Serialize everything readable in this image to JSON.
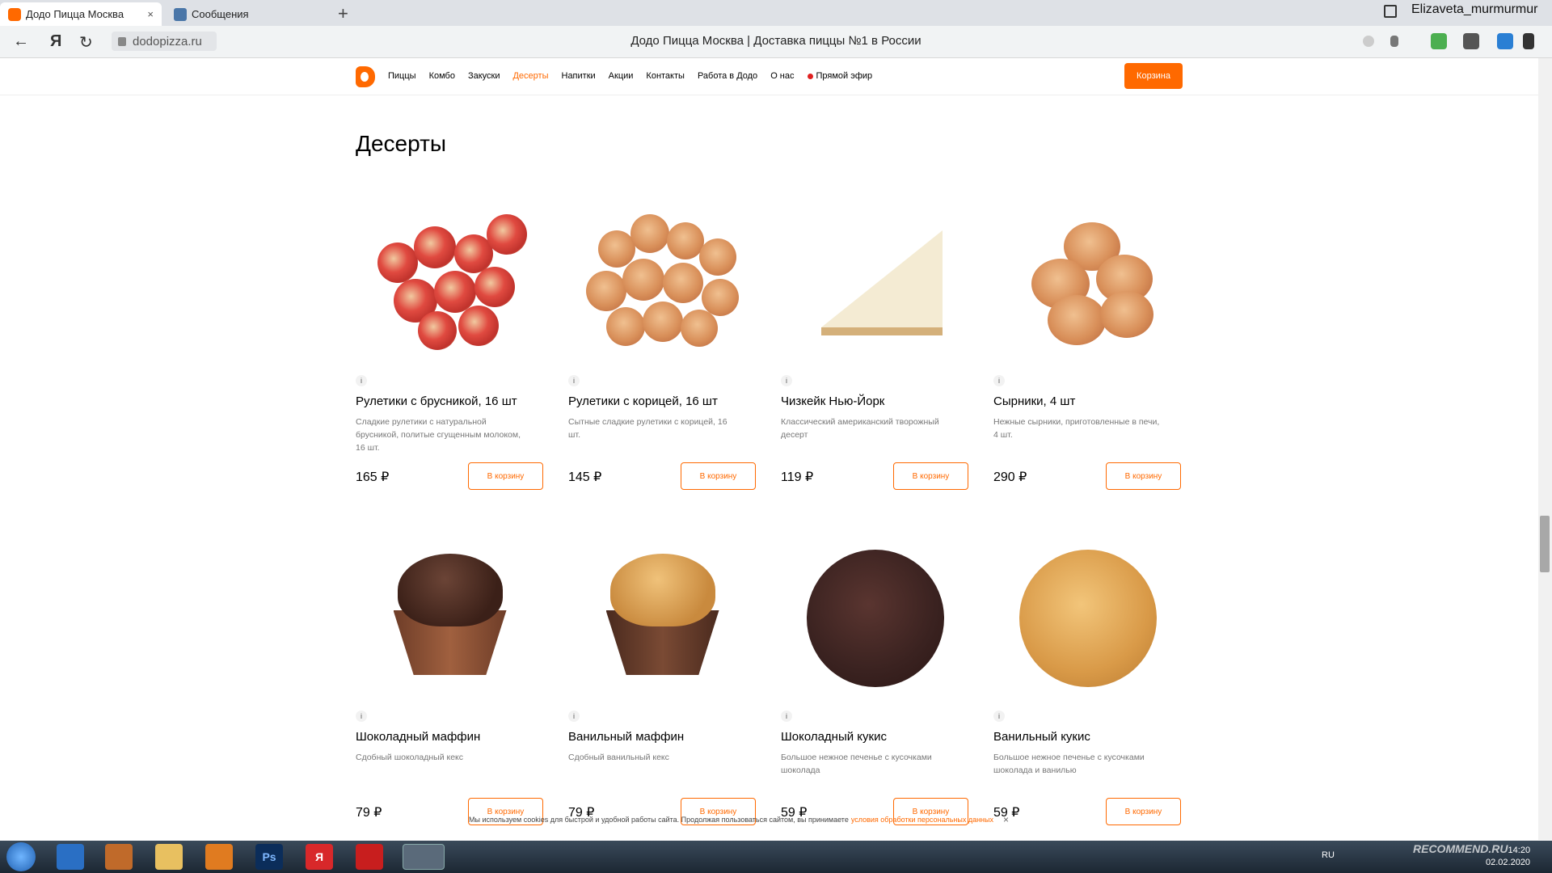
{
  "browser": {
    "tabs": [
      {
        "title": "Додо Пицца Москва",
        "close": "×"
      },
      {
        "title": "Сообщения"
      }
    ],
    "new_tab": "+",
    "profile_name": "Elizaveta_murmurmur",
    "url": "dodopizza.ru",
    "page_title": "Додо Пицца Москва | Доставка пиццы №1 в России",
    "back": "←",
    "yandex": "Я",
    "reload": "↻"
  },
  "site": {
    "nav": [
      "Пиццы",
      "Комбо",
      "Закуски",
      "Десерты",
      "Напитки",
      "Акции",
      "Контакты",
      "Работа в Додо",
      "О нас",
      "Прямой эфир"
    ],
    "active_nav": "Десерты",
    "cart_label": "Корзина",
    "heading": "Десерты",
    "info_glyph": "i",
    "add_label": "В корзину",
    "products": [
      {
        "title": "Рулетики с брусникой, 16 шт",
        "desc": "Сладкие рулетики с натуральной брусникой, политые сгущенным молоком, 16 шт.",
        "price": "165 ₽"
      },
      {
        "title": "Рулетики с корицей, 16 шт",
        "desc": "Сытные сладкие рулетики с корицей, 16 шт.",
        "price": "145 ₽"
      },
      {
        "title": "Чизкейк Нью-Йорк",
        "desc": "Классический американский творожный десерт",
        "price": "119 ₽"
      },
      {
        "title": "Сырники, 4 шт",
        "desc": "Нежные сырники, приготовленные в печи, 4 шт.",
        "price": "290 ₽"
      },
      {
        "title": "Шоколадный маффин",
        "desc": "Сдобный шоколадный кекс",
        "price": "79 ₽"
      },
      {
        "title": "Ванильный маффин",
        "desc": "Сдобный ванильный кекс",
        "price": "79 ₽"
      },
      {
        "title": "Шоколадный кукис",
        "desc": "Большое нежное печенье с кусочками шоколада",
        "price": "59 ₽"
      },
      {
        "title": "Ванильный кукис",
        "desc": "Большое нежное печенье с кусочками шоколада и ванилью",
        "price": "59 ₽"
      }
    ],
    "cookie_notice": "Мы используем cookies для быстрой и удобной работы сайта. Продолжая пользоваться сайтом, вы принимаете",
    "cookie_link": "условия обработки персональных данных",
    "cookie_close": "×"
  },
  "taskbar": {
    "lang": "RU",
    "time": "14:20",
    "date": "02.02.2020",
    "ps_label": "Ps",
    "y_label": "Я",
    "watermark": "RECOMMEND.RU"
  },
  "colors": {
    "brand": "#ff6900",
    "live": "#e02020"
  }
}
